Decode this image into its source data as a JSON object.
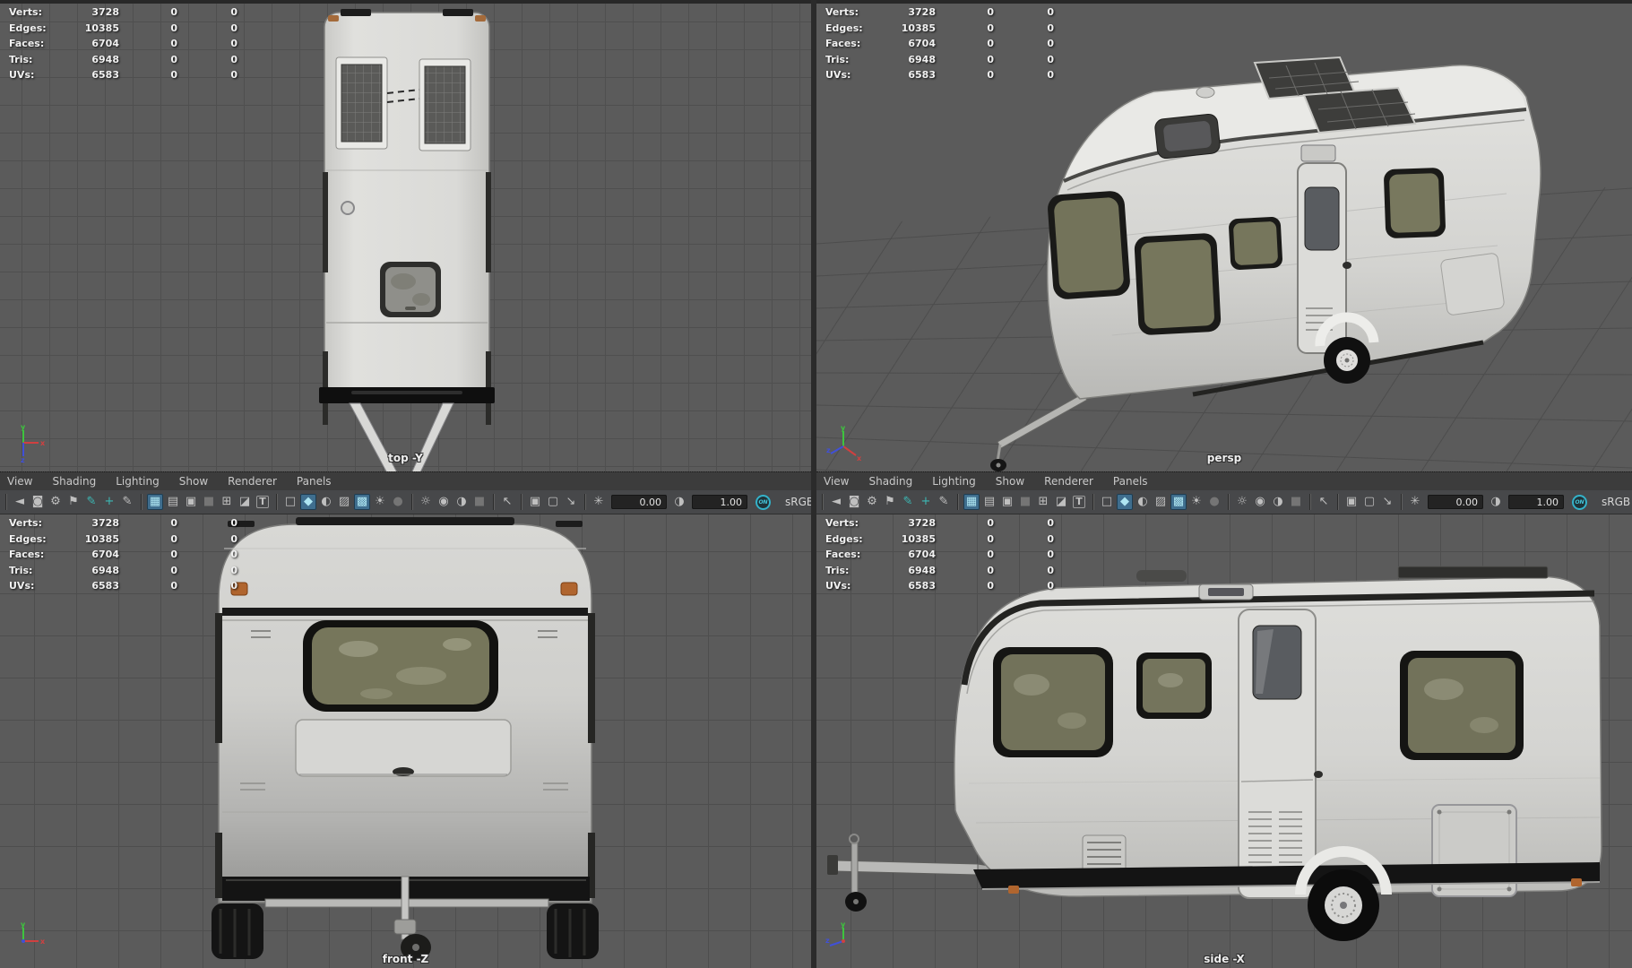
{
  "hud": {
    "rows": [
      {
        "label": "Verts:",
        "value": "3728",
        "col2": "0",
        "col3": "0"
      },
      {
        "label": "Edges:",
        "value": "10385",
        "col2": "0",
        "col3": "0"
      },
      {
        "label": "Faces:",
        "value": "6704",
        "col2": "0",
        "col3": "0"
      },
      {
        "label": "Tris:",
        "value": "6948",
        "col2": "0",
        "col3": "0"
      },
      {
        "label": "UVs:",
        "value": "6583",
        "col2": "0",
        "col3": "0"
      }
    ]
  },
  "menu": {
    "items": [
      {
        "name": "menu-view",
        "label": "View"
      },
      {
        "name": "menu-shading",
        "label": "Shading"
      },
      {
        "name": "menu-lighting",
        "label": "Lighting"
      },
      {
        "name": "menu-show",
        "label": "Show"
      },
      {
        "name": "menu-renderer",
        "label": "Renderer"
      },
      {
        "name": "menu-panels",
        "label": "Panels"
      }
    ]
  },
  "toolbar": {
    "group_camera": [
      {
        "name": "viewport-camera-icon",
        "glyph": "◄",
        "state": "normal"
      },
      {
        "name": "lock-camera-icon",
        "glyph": "◙",
        "state": "normal"
      },
      {
        "name": "camera-attributes-icon",
        "glyph": "⚙",
        "state": "normal"
      },
      {
        "name": "bookmark-icon",
        "glyph": "⚑",
        "state": "normal"
      }
    ],
    "group_tools": [
      {
        "name": "pan-zoom-icon",
        "glyph": "✎",
        "state": "teal"
      },
      {
        "name": "move-pivot-icon",
        "glyph": "+",
        "state": "teal"
      },
      {
        "name": "grease-pencil-icon",
        "glyph": "✎",
        "state": "normal"
      }
    ],
    "group_gates": [
      {
        "name": "grid-icon",
        "glyph": "▦",
        "state": "active"
      },
      {
        "name": "film-gate-icon",
        "glyph": "▤",
        "state": "normal"
      },
      {
        "name": "resolution-gate-icon",
        "glyph": "▣",
        "state": "normal"
      },
      {
        "name": "gate-mask-icon",
        "glyph": "■",
        "state": "dim"
      },
      {
        "name": "field-chart-icon",
        "glyph": "⊞",
        "state": "normal"
      },
      {
        "name": "safe-action-icon",
        "glyph": "◪",
        "state": "normal"
      },
      {
        "name": "safe-title-icon",
        "glyph": "T",
        "state": "boxed"
      }
    ],
    "group_shading": [
      {
        "name": "wireframe-icon",
        "glyph": "□",
        "state": "normal"
      },
      {
        "name": "smooth-shade-icon",
        "glyph": "◆",
        "state": "active"
      },
      {
        "name": "flat-shade-icon",
        "glyph": "◐",
        "state": "normal"
      },
      {
        "name": "textured-icon",
        "glyph": "▨",
        "state": "normal"
      },
      {
        "name": "wireframe-on-shaded-icon",
        "glyph": "▩",
        "state": "active"
      },
      {
        "name": "default-lighting-icon",
        "glyph": "☀",
        "state": "normal"
      },
      {
        "name": "shadows-icon",
        "glyph": "●",
        "state": "dim"
      }
    ],
    "group_lights": [
      {
        "name": "all-lights-icon",
        "glyph": "☼",
        "state": "normal"
      },
      {
        "name": "two-sided-lighting-icon",
        "glyph": "◉",
        "state": "normal"
      },
      {
        "name": "ambient-occlusion-icon",
        "glyph": "◑",
        "state": "normal"
      },
      {
        "name": "motion-blur-icon",
        "glyph": "■",
        "state": "dim"
      }
    ],
    "group_select": [
      {
        "name": "marquee-select-icon",
        "glyph": "↖",
        "state": "normal"
      }
    ],
    "group_isolate": [
      {
        "name": "isolate-select-icon",
        "glyph": "▣",
        "state": "normal"
      },
      {
        "name": "isolate-add-icon",
        "glyph": "▢",
        "state": "normal"
      },
      {
        "name": "zoom-selected-icon",
        "glyph": "↘",
        "state": "normal"
      }
    ],
    "exposure": {
      "icon_glyph": "✳",
      "value": "0.00"
    },
    "gamma": {
      "icon_glyph": "◑",
      "value": "1.00"
    },
    "toggle": {
      "label": "ON"
    },
    "colorspace": {
      "label": "sRGB gamma"
    }
  },
  "viewports": {
    "top": {
      "label": "top -Y"
    },
    "persp": {
      "label": "persp"
    },
    "front": {
      "label": "front -Z"
    },
    "side": {
      "label": "side -X"
    }
  },
  "axis": {
    "x": "x",
    "y": "y",
    "z": "z"
  },
  "colors": {
    "active_button": "#3f6e8e",
    "teal_icon": "#3cb8b4",
    "hud_text": "#f1f1f1",
    "window_olive": "#76765b",
    "body_white": "#d9d9d6",
    "viewport_bg": "#5b5b5b"
  }
}
